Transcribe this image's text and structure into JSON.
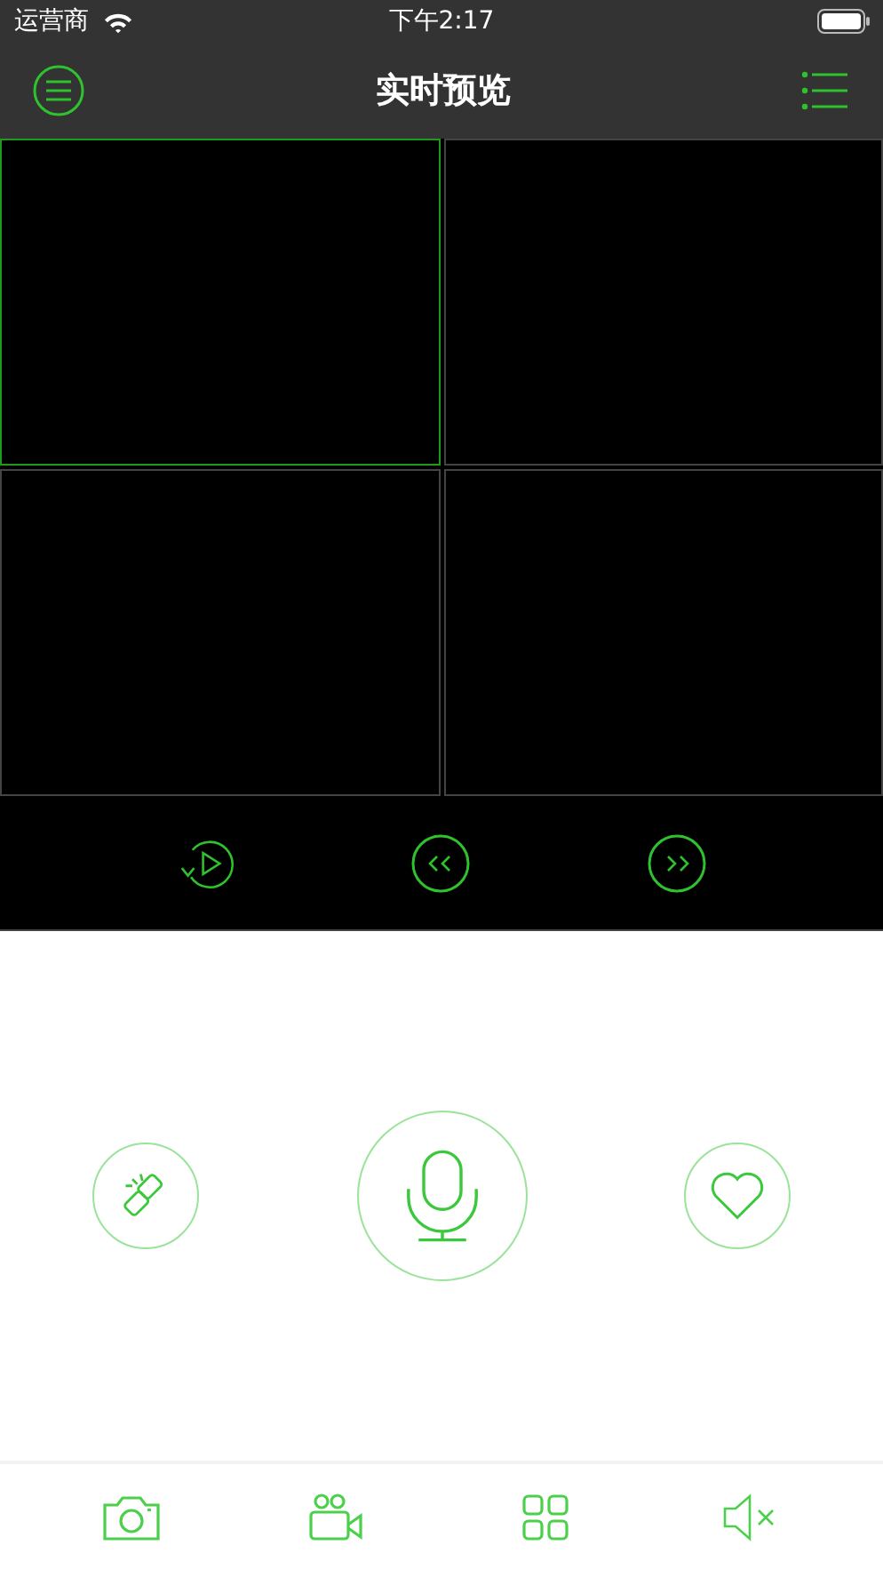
{
  "status_bar": {
    "carrier": "运营商",
    "time": "下午2:17"
  },
  "nav_bar": {
    "title": "实时预览"
  },
  "video_tiles": [
    {
      "selected": true
    },
    {
      "selected": false
    },
    {
      "selected": false
    },
    {
      "selected": false
    }
  ]
}
